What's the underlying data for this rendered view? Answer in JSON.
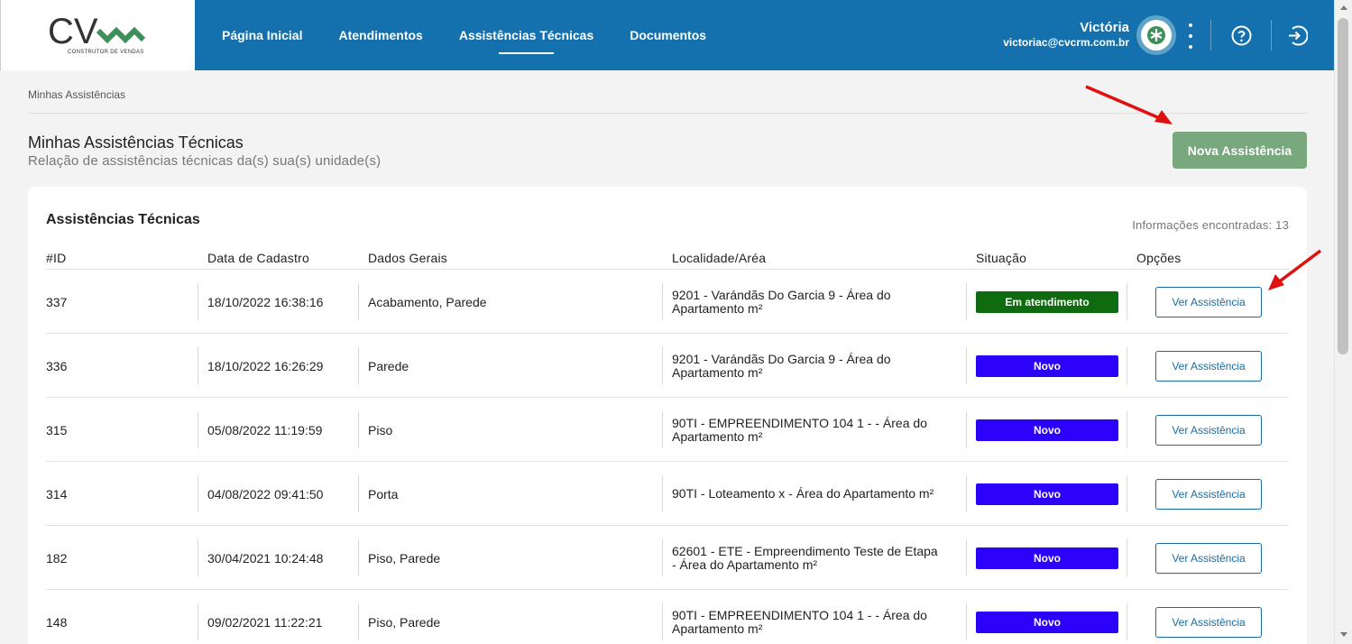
{
  "header": {
    "logo_text": "CV",
    "logo_subtitle": "CONSTRUTOR DE VENDAS",
    "nav": [
      {
        "label": "Página Inicial"
      },
      {
        "label": "Atendimentos"
      },
      {
        "label": "Assistências Técnicas"
      },
      {
        "label": "Documentos"
      }
    ],
    "active_nav": "Assistências Técnicas",
    "user": {
      "name": "Victória",
      "email": "victoriac@cvcrm.com.br"
    }
  },
  "breadcrumb": "Minhas Assistências",
  "page": {
    "title": "Minhas Assistências Técnicas",
    "subtitle": "Relação de assistências técnicas da(s) sua(s) unidade(s)",
    "new_button": "Nova Assistência"
  },
  "card": {
    "title": "Assistências Técnicas",
    "found": "Informações encontradas: 13",
    "columns": [
      "#ID",
      "Data de Cadastro",
      "Dados Gerais",
      "Localidade/Aréa",
      "Situação",
      "Opções"
    ],
    "rows": [
      {
        "id": "337",
        "date": "18/10/2022 16:38:16",
        "general": "Acabamento, Parede",
        "location": "9201 - Varándãs Do Garcia 9 - Área do Apartamento m²",
        "status": "Em atendimento",
        "status_color": "#0f6b0f",
        "action": "Ver Assistência"
      },
      {
        "id": "336",
        "date": "18/10/2022 16:26:29",
        "general": "Parede",
        "location": "9201 - Varándãs Do Garcia 9 - Área do Apartamento m²",
        "status": "Novo",
        "status_color": "#2d02fb",
        "action": "Ver Assistência"
      },
      {
        "id": "315",
        "date": "05/08/2022 11:19:59",
        "general": "Piso",
        "location": "90TI - EMPREENDIMENTO 104 1 - - Área do Apartamento m²",
        "status": "Novo",
        "status_color": "#2d02fb",
        "action": "Ver Assistência"
      },
      {
        "id": "314",
        "date": "04/08/2022 09:41:50",
        "general": "Porta",
        "location": "90TI - Loteamento x - Área do Apartamento m²",
        "status": "Novo",
        "status_color": "#2d02fb",
        "action": "Ver Assistência"
      },
      {
        "id": "182",
        "date": "30/04/2021 10:24:48",
        "general": "Piso, Parede",
        "location": "62601 - ETE - Empreendimento Teste de Etapa - Área do Apartamento m²",
        "status": "Novo",
        "status_color": "#2d02fb",
        "action": "Ver Assistência"
      },
      {
        "id": "148",
        "date": "09/02/2021 11:22:21",
        "general": "Piso, Parede",
        "location": "90TI - EMPREENDIMENTO 104 1 - - Área do Apartamento m²",
        "status": "Novo",
        "status_color": "#2d02fb",
        "action": "Ver Assistência"
      }
    ]
  },
  "colors": {
    "header": "#1471ad",
    "primary_button": "#7aa87e",
    "link": "#1a6ca3",
    "arrow": "#e01010"
  }
}
